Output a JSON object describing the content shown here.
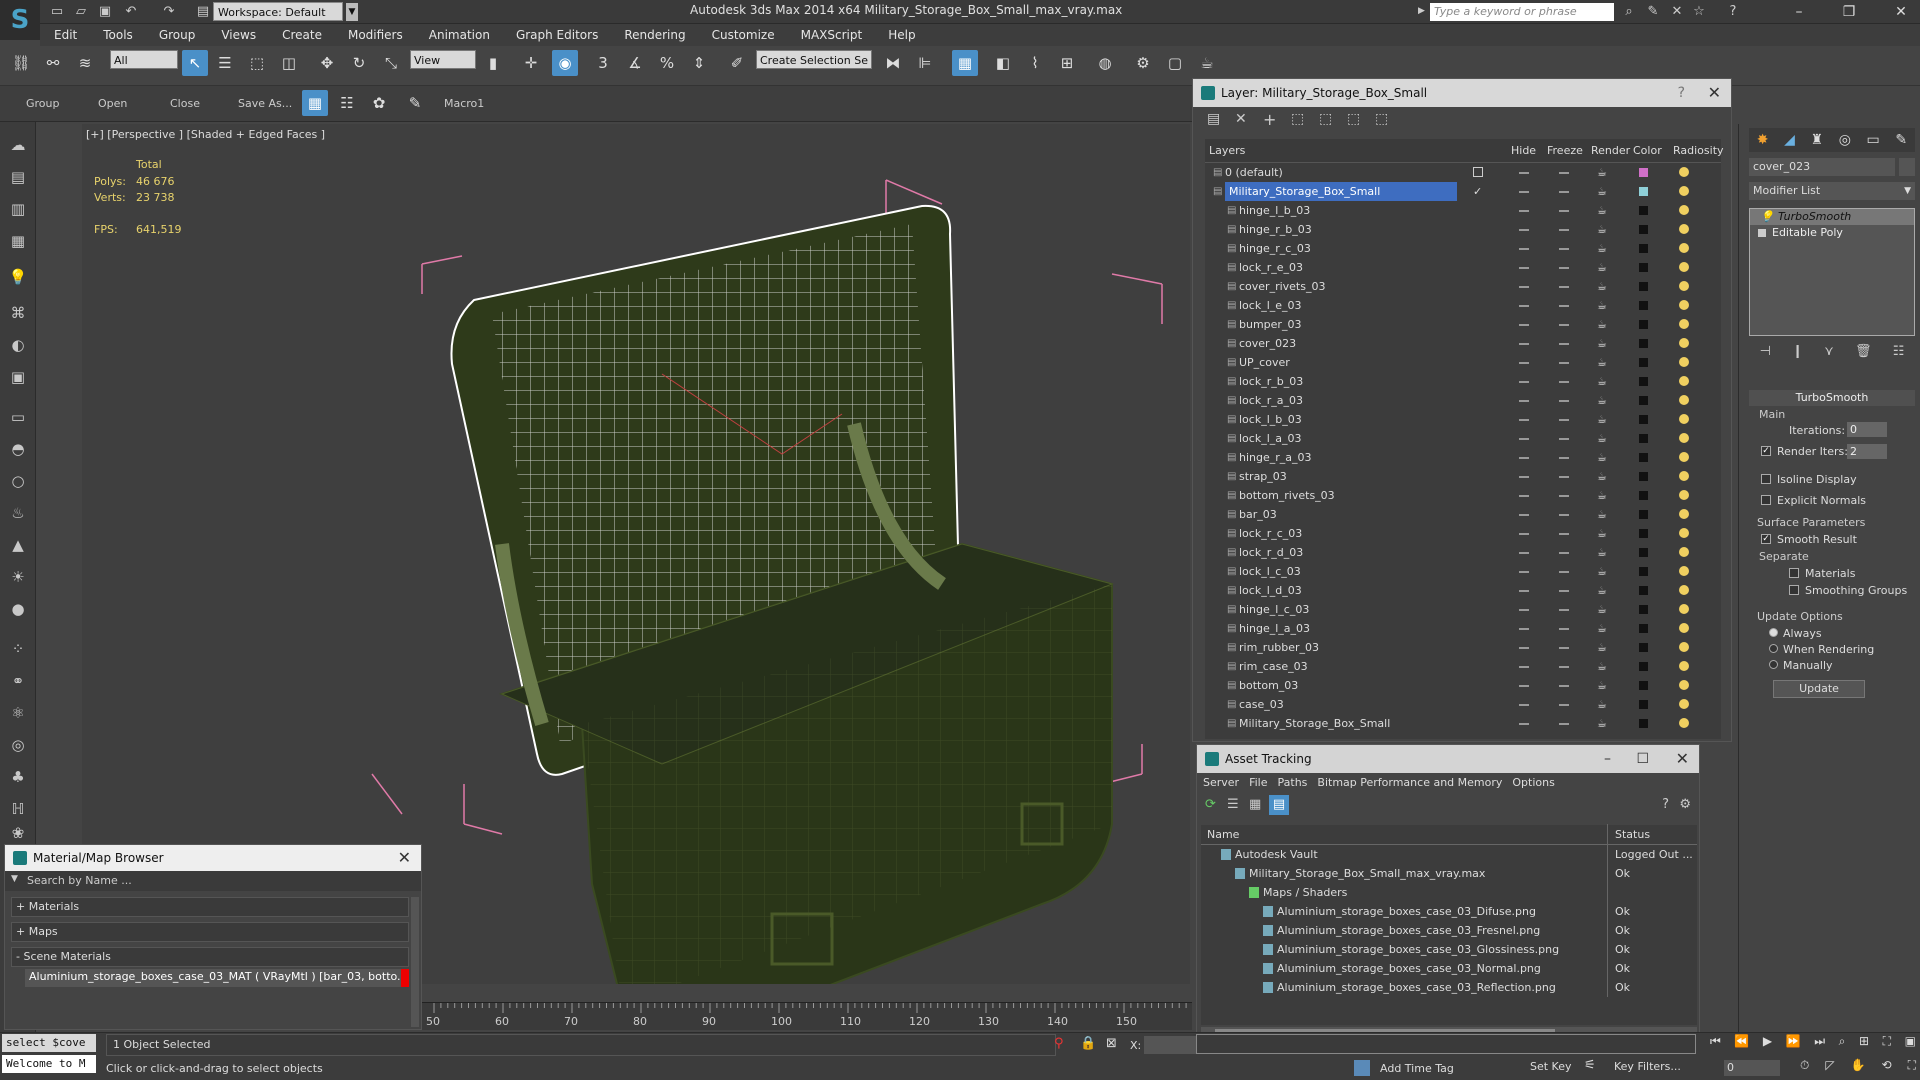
{
  "app": {
    "workspace": "Workspace: Default",
    "title": "Autodesk 3ds Max  2014 x64    Military_Storage_Box_Small_max_vray.max",
    "search_placeholder": "Type a keyword or phrase"
  },
  "menus": [
    "Edit",
    "Tools",
    "Group",
    "Views",
    "Create",
    "Modifiers",
    "Animation",
    "Graph Editors",
    "Rendering",
    "Customize",
    "MAXScript",
    "Help"
  ],
  "toolbar": {
    "filter": "All",
    "view": "View",
    "selection_set": "Create Selection Se"
  },
  "ribbon": {
    "group": "Group",
    "open": "Open",
    "close": "Close",
    "save_as": "Save As...",
    "macro": "Macro1"
  },
  "viewport": {
    "label": "[+] [Perspective ] [Shaded + Edged Faces ]",
    "total_label": "Total",
    "polys_label": "Polys:",
    "polys": "46 676",
    "verts_label": "Verts:",
    "verts": "23 738",
    "fps_label": "FPS:",
    "fps": "641,519"
  },
  "layers": {
    "title": "Layer: Military_Storage_Box_Small",
    "cols": {
      "layers": "Layers",
      "hide": "Hide",
      "freeze": "Freeze",
      "render": "Render",
      "color": "Color",
      "radiosity": "Radiosity"
    },
    "rows": [
      {
        "name": "0 (default)",
        "level": 0,
        "color": "#d070c8"
      },
      {
        "name": "Military_Storage_Box_Small",
        "level": 0,
        "color": "#8fd0d8",
        "selected": true
      },
      {
        "name": "hinge_l_b_03",
        "level": 1,
        "color": "#111111"
      },
      {
        "name": "hinge_r_b_03",
        "level": 1,
        "color": "#111111"
      },
      {
        "name": "hinge_r_c_03",
        "level": 1,
        "color": "#111111"
      },
      {
        "name": "lock_r_e_03",
        "level": 1,
        "color": "#111111"
      },
      {
        "name": "cover_rivets_03",
        "level": 1,
        "color": "#111111"
      },
      {
        "name": "lock_l_e_03",
        "level": 1,
        "color": "#111111"
      },
      {
        "name": "bumper_03",
        "level": 1,
        "color": "#111111"
      },
      {
        "name": "cover_023",
        "level": 1,
        "color": "#111111"
      },
      {
        "name": "UP_cover",
        "level": 1,
        "color": "#111111"
      },
      {
        "name": "lock_r_b_03",
        "level": 1,
        "color": "#111111"
      },
      {
        "name": "lock_r_a_03",
        "level": 1,
        "color": "#111111"
      },
      {
        "name": "lock_l_b_03",
        "level": 1,
        "color": "#111111"
      },
      {
        "name": "lock_l_a_03",
        "level": 1,
        "color": "#111111"
      },
      {
        "name": "hinge_r_a_03",
        "level": 1,
        "color": "#111111"
      },
      {
        "name": "strap_03",
        "level": 1,
        "color": "#111111"
      },
      {
        "name": "bottom_rivets_03",
        "level": 1,
        "color": "#111111"
      },
      {
        "name": "bar_03",
        "level": 1,
        "color": "#111111"
      },
      {
        "name": "lock_r_c_03",
        "level": 1,
        "color": "#111111"
      },
      {
        "name": "lock_r_d_03",
        "level": 1,
        "color": "#111111"
      },
      {
        "name": "lock_l_c_03",
        "level": 1,
        "color": "#111111"
      },
      {
        "name": "lock_l_d_03",
        "level": 1,
        "color": "#111111"
      },
      {
        "name": "hinge_l_c_03",
        "level": 1,
        "color": "#111111"
      },
      {
        "name": "hinge_l_a_03",
        "level": 1,
        "color": "#111111"
      },
      {
        "name": "rim_rubber_03",
        "level": 1,
        "color": "#111111"
      },
      {
        "name": "rim_case_03",
        "level": 1,
        "color": "#111111"
      },
      {
        "name": "bottom_03",
        "level": 1,
        "color": "#111111"
      },
      {
        "name": "case_03",
        "level": 1,
        "color": "#111111"
      },
      {
        "name": "Military_Storage_Box_Small",
        "level": 1,
        "color": "#111111"
      }
    ]
  },
  "cmd": {
    "object_name": "cover_023",
    "modifier_list": "Modifier List",
    "stack": [
      "TurboSmooth",
      "Editable Poly"
    ],
    "rollout": "TurboSmooth",
    "main": "Main",
    "iterations_label": "Iterations:",
    "iterations": "0",
    "render_iters_label": "Render Iters:",
    "render_iters": "2",
    "isoline": "Isoline Display",
    "explicit_normals": "Explicit Normals",
    "surface_params": "Surface Parameters",
    "smooth_result": "Smooth Result",
    "separate": "Separate",
    "materials": "Materials",
    "smoothing_groups": "Smoothing Groups",
    "update_options": "Update Options",
    "always": "Always",
    "when_rendering": "When Rendering",
    "manually": "Manually",
    "update_btn": "Update"
  },
  "asset": {
    "title": "Asset Tracking",
    "menus": [
      "Server",
      "File",
      "Paths",
      "Bitmap Performance and Memory",
      "Options"
    ],
    "col_name": "Name",
    "col_status": "Status",
    "rows": [
      {
        "name": "Autodesk Vault",
        "status": "Logged Out ...",
        "indent": 0
      },
      {
        "name": "Military_Storage_Box_Small_max_vray.max",
        "status": "Ok",
        "indent": 1
      },
      {
        "name": "Maps / Shaders",
        "status": "",
        "indent": 2
      },
      {
        "name": "Aluminium_storage_boxes_case_03_Difuse.png",
        "status": "Ok",
        "indent": 3
      },
      {
        "name": "Aluminium_storage_boxes_case_03_Fresnel.png",
        "status": "Ok",
        "indent": 3
      },
      {
        "name": "Aluminium_storage_boxes_case_03_Glossiness.png",
        "status": "Ok",
        "indent": 3
      },
      {
        "name": "Aluminium_storage_boxes_case_03_Normal.png",
        "status": "Ok",
        "indent": 3
      },
      {
        "name": "Aluminium_storage_boxes_case_03_Reflection.png",
        "status": "Ok",
        "indent": 3
      }
    ]
  },
  "matbrowser": {
    "title": "Material/Map Browser",
    "search_placeholder": "Search by Name ...",
    "materials": "+ Materials",
    "maps": "+ Maps",
    "scene_materials": "- Scene Materials",
    "item": "Aluminium_storage_boxes_case_03_MAT ( VRayMtl ) [bar_03, botto..."
  },
  "timeline": {
    "ticks": [
      "50",
      "60",
      "70",
      "80",
      "90",
      "100",
      "110",
      "120",
      "130",
      "140",
      "150"
    ]
  },
  "status": {
    "script1": "select $cove",
    "script2": "Welcome to M",
    "selected": "1 Object Selected",
    "prompt": "Click or click-and-drag to select objects",
    "add_time_tag": "Add Time Tag",
    "set_key": "Set Key",
    "key_filters": "Key Filters...",
    "x_label": "X:",
    "frame": "0"
  }
}
